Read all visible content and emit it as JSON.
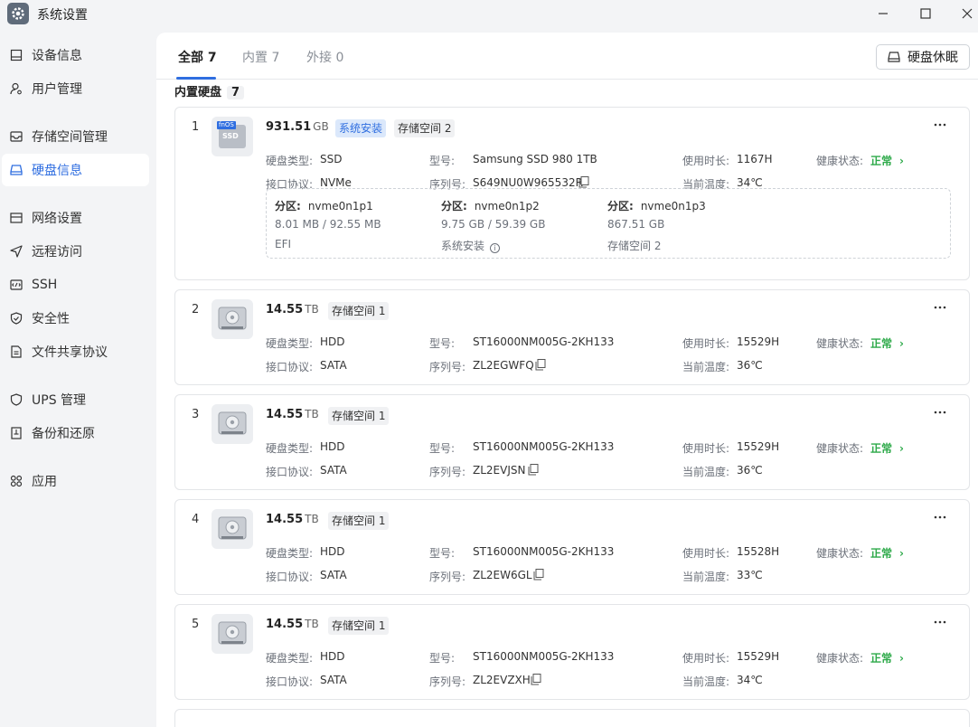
{
  "window": {
    "title": "系统设置"
  },
  "sidebar": {
    "items": [
      {
        "label": "设备信息",
        "icon": "device-icon"
      },
      {
        "label": "用户管理",
        "icon": "user-icon"
      },
      {
        "label": "存储空间管理",
        "icon": "storage-icon"
      },
      {
        "label": "硬盘信息",
        "icon": "disk-icon",
        "active": true
      },
      {
        "label": "网络设置",
        "icon": "network-icon"
      },
      {
        "label": "远程访问",
        "icon": "remote-icon"
      },
      {
        "label": "SSH",
        "icon": "ssh-icon"
      },
      {
        "label": "安全性",
        "icon": "shield-icon"
      },
      {
        "label": "文件共享协议",
        "icon": "file-share-icon"
      },
      {
        "label": "UPS 管理",
        "icon": "ups-icon"
      },
      {
        "label": "备份和还原",
        "icon": "backup-icon"
      },
      {
        "label": "应用",
        "icon": "apps-icon"
      }
    ]
  },
  "tabs": [
    {
      "label": "全部 7",
      "active": true
    },
    {
      "label": "内置 7"
    },
    {
      "label": "外接 0"
    }
  ],
  "sleep_button": "硬盘休眠",
  "section": {
    "title": "内置硬盘",
    "count": "7"
  },
  "labels": {
    "disk_type": "硬盘类型:",
    "interface": "接口协议:",
    "model": "型号:",
    "serial": "序列号:",
    "uptime": "使用时长:",
    "temp": "当前温度:",
    "health": "健康状态:",
    "partition": "分区:"
  },
  "disks": [
    {
      "index": "1",
      "size": "931.51",
      "unit": "GB",
      "tags": [
        "系统安装",
        "存储空间 2"
      ],
      "type": "SSD",
      "interface": "NVMe",
      "model": "Samsung SSD 980 1TB",
      "serial": "S649NU0W965532R",
      "uptime": "1167H",
      "temp": "34℃",
      "health": "正常",
      "icon_badge": "fnOS",
      "icon_text": "SSD",
      "partitions": [
        {
          "name": "nvme0n1p1",
          "usage": "8.01 MB / 92.55 MB",
          "use": "EFI"
        },
        {
          "name": "nvme0n1p2",
          "usage": "9.75 GB / 59.39 GB",
          "use": "系统安装"
        },
        {
          "name": "nvme0n1p3",
          "usage": "867.51 GB",
          "use": "存储空间 2"
        }
      ]
    },
    {
      "index": "2",
      "size": "14.55",
      "unit": "TB",
      "tags": [
        "存储空间 1"
      ],
      "type": "HDD",
      "interface": "SATA",
      "model": "ST16000NM005G-2KH133",
      "serial": "ZL2EGWFQ",
      "uptime": "15529H",
      "temp": "36℃",
      "health": "正常"
    },
    {
      "index": "3",
      "size": "14.55",
      "unit": "TB",
      "tags": [
        "存储空间 1"
      ],
      "type": "HDD",
      "interface": "SATA",
      "model": "ST16000NM005G-2KH133",
      "serial": "ZL2EVJSN",
      "uptime": "15529H",
      "temp": "36℃",
      "health": "正常"
    },
    {
      "index": "4",
      "size": "14.55",
      "unit": "TB",
      "tags": [
        "存储空间 1"
      ],
      "type": "HDD",
      "interface": "SATA",
      "model": "ST16000NM005G-2KH133",
      "serial": "ZL2EW6GL",
      "uptime": "15528H",
      "temp": "33℃",
      "health": "正常"
    },
    {
      "index": "5",
      "size": "14.55",
      "unit": "TB",
      "tags": [
        "存储空间 1"
      ],
      "type": "HDD",
      "interface": "SATA",
      "model": "ST16000NM005G-2KH133",
      "serial": "ZL2EVZXH",
      "uptime": "15529H",
      "temp": "34℃",
      "health": "正常"
    }
  ],
  "colors": {
    "accent": "#2f6ee0",
    "healthy": "#2eaa4a",
    "sidebar_bg": "#f3f4f6"
  }
}
